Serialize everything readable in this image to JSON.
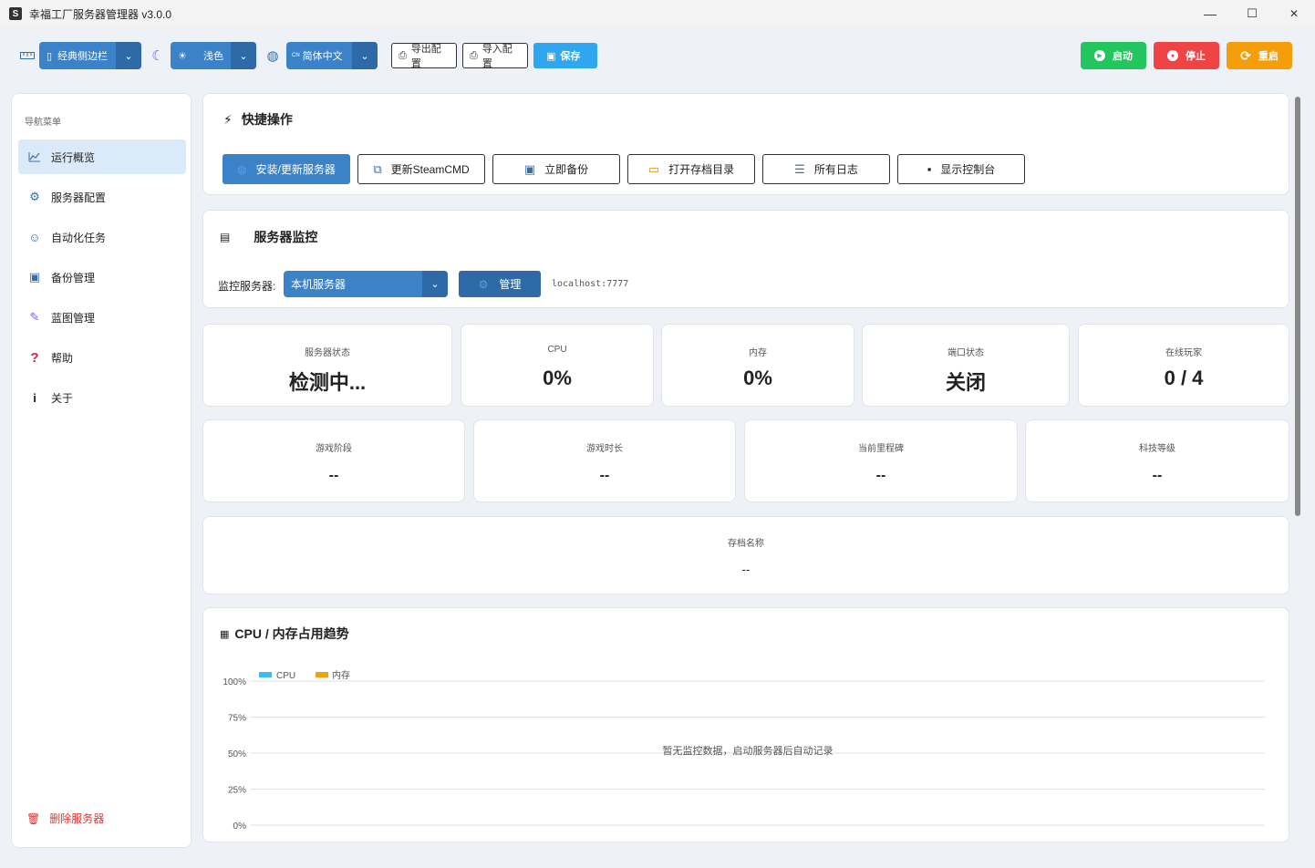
{
  "window": {
    "title": "幸福工厂服务器管理器 v3.0.0",
    "app_icon": "S",
    "minimize": "—",
    "maximize": "☐",
    "close": "✕"
  },
  "toolbar": {
    "layout_select": "经典侧边栏",
    "theme_select": "浅色",
    "language_select": "简体中文",
    "language_prefix": "CN",
    "export_label": "导出配置",
    "import_label": "导入配置",
    "save_label": "保存",
    "start_label": "启动",
    "stop_label": "停止",
    "restart_label": "重启"
  },
  "sidebar": {
    "heading": "导航菜单",
    "items": [
      {
        "label": "运行概览",
        "icon": "chart-line-icon"
      },
      {
        "label": "服务器配置",
        "icon": "gear-icon"
      },
      {
        "label": "自动化任务",
        "icon": "robot-icon"
      },
      {
        "label": "备份管理",
        "icon": "floppy-icon"
      },
      {
        "label": "蓝图管理",
        "icon": "wrench-icon"
      },
      {
        "label": "帮助",
        "icon": "question-icon"
      },
      {
        "label": "关于",
        "icon": "info-icon"
      }
    ],
    "delete_label": "删除服务器"
  },
  "quick_actions": {
    "title": "快捷操作",
    "buttons": [
      "安装/更新服务器",
      "更新SteamCMD",
      "立即备份",
      "打开存档目录",
      "所有日志",
      "显示控制台"
    ]
  },
  "monitor": {
    "title": "服务器监控",
    "server_label": "监控服务器:",
    "server_value": "本机服务器",
    "manage_label": "管理",
    "address": "localhost:7777"
  },
  "stats_row1": [
    {
      "label": "服务器状态",
      "value": "检测中..."
    },
    {
      "label": "CPU",
      "value": "0%"
    },
    {
      "label": "内存",
      "value": "0%"
    },
    {
      "label": "端口状态",
      "value": "关闭"
    },
    {
      "label": "在线玩家",
      "value": "0 / 4"
    }
  ],
  "stats_row2": [
    {
      "label": "游戏阶段",
      "value": "--"
    },
    {
      "label": "游戏时长",
      "value": "--"
    },
    {
      "label": "当前里程碑",
      "value": "--"
    },
    {
      "label": "科技等级",
      "value": "--"
    }
  ],
  "save_card": {
    "label": "存档名称",
    "value": "--"
  },
  "colors": {
    "primary": "#3b82c9",
    "start": "#22c55e",
    "stop": "#ef4444",
    "restart": "#f59e0b",
    "cpu": "#38bdf8",
    "memory": "#f59e0b"
  },
  "chart_data": {
    "type": "line",
    "title": "CPU / 内存占用趋势",
    "series": [
      {
        "name": "CPU",
        "values": []
      },
      {
        "name": "内存",
        "values": []
      }
    ],
    "y_ticks": [
      "100%",
      "75%",
      "50%",
      "25%",
      "0%"
    ],
    "ylim": [
      0,
      100
    ],
    "grid": true,
    "legend": "top-left",
    "empty_message": "暂无监控数据，启动服务器后自动记录"
  }
}
